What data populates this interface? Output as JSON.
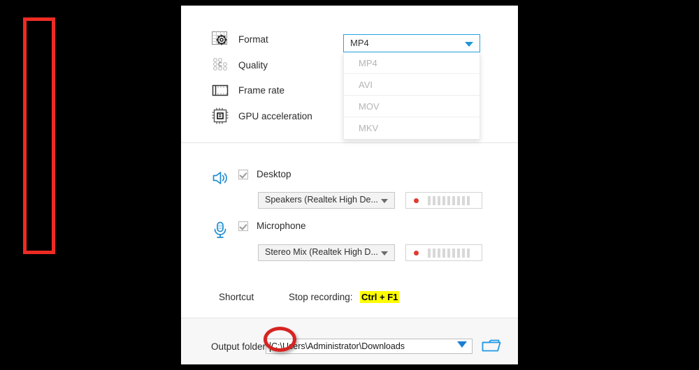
{
  "panel": {
    "settings": [
      {
        "icon": "format-icon",
        "label": "Format"
      },
      {
        "icon": "quality-icon",
        "label": "Quality"
      },
      {
        "icon": "frame-rate-icon",
        "label": "Frame rate"
      },
      {
        "icon": "gpu-acceleration-icon",
        "label": "GPU acceleration"
      }
    ],
    "format_select": {
      "value": "MP4",
      "expanded": true,
      "options": [
        "MP4",
        "AVI",
        "MOV",
        "MKV"
      ],
      "border_color": "#27a4df",
      "arrow_color": "#2196d6"
    },
    "audio": {
      "desktop": {
        "icon": "speaker-icon",
        "label": "Desktop",
        "checked": true,
        "device": "Speakers (Realtek High De...",
        "meter_bars": 9
      },
      "microphone": {
        "icon": "microphone-icon",
        "label": "Microphone",
        "checked": true,
        "device": "Stereo Mix (Realtek High D...",
        "meter_bars": 9
      }
    },
    "shortcut": {
      "label": "Shortcut",
      "action_label": "Stop recording:",
      "keys": "Ctrl + F1",
      "highlight_color": "#ffff00"
    },
    "output": {
      "label": "Output folder:",
      "path": "C:\\Users\\Administrator\\Downloads",
      "dropdown_icon": "chevron-down-icon",
      "browse_icon": "folder-icon"
    }
  },
  "annotations": {
    "rect": {
      "name": "highlight-rectangle",
      "color": "#ee2b23"
    },
    "circle": {
      "name": "highlight-circle",
      "color": "#d62421"
    }
  }
}
